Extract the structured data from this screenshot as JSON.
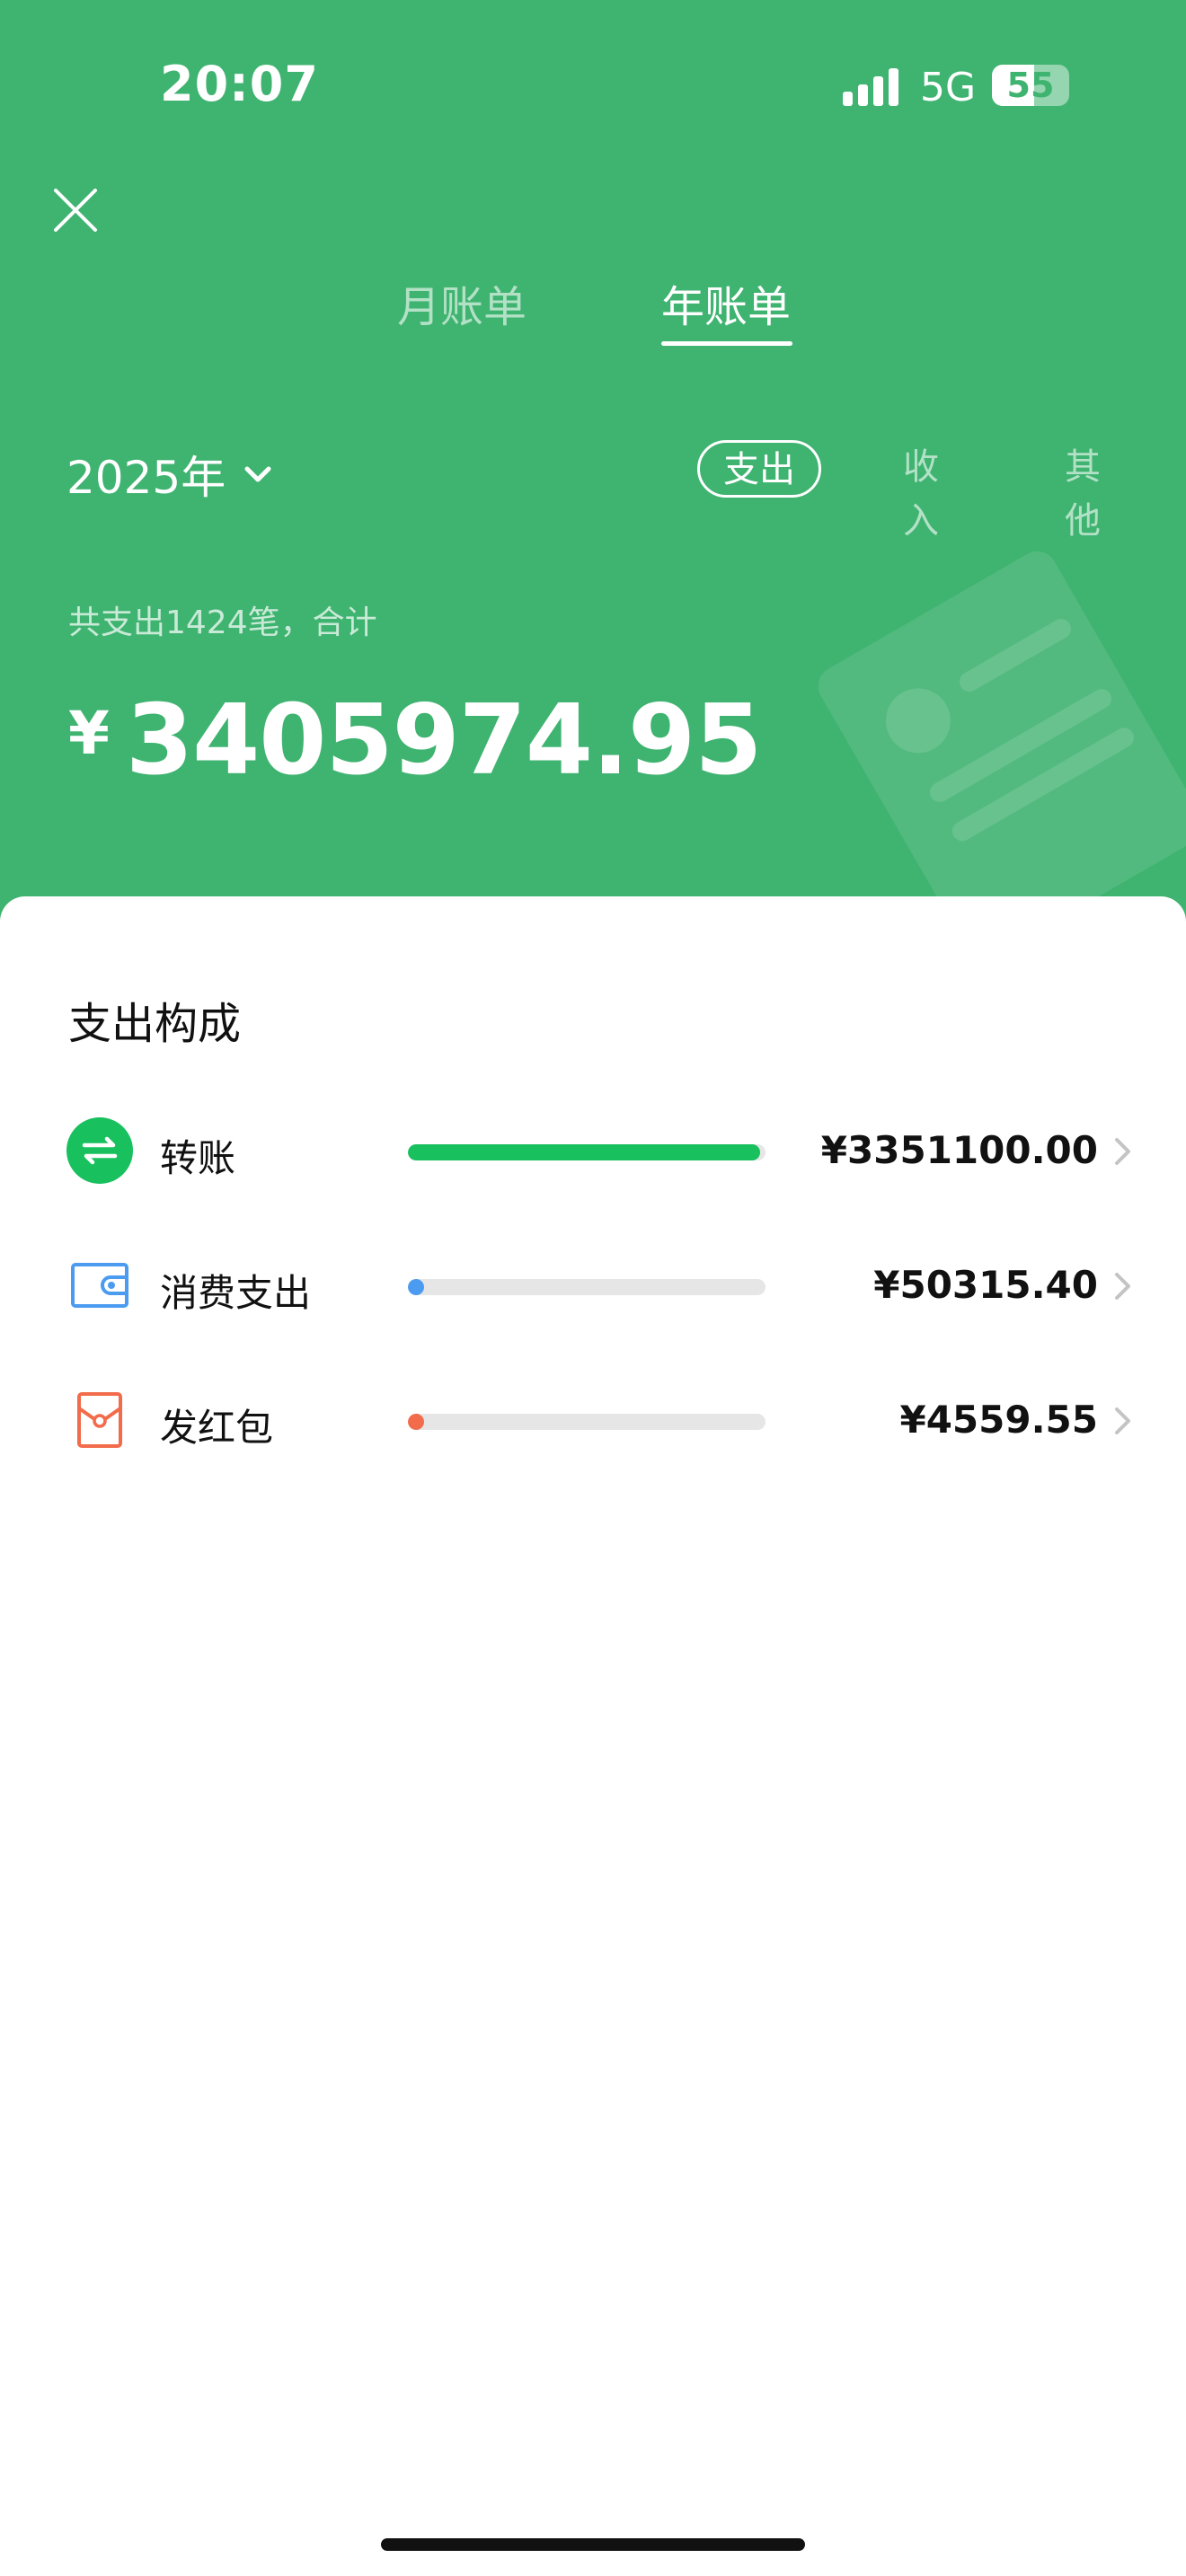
{
  "status_bar": {
    "time": "20:07",
    "network": "5G",
    "battery": "55",
    "battery_level": 0.55
  },
  "nav": {
    "close_icon": "close-icon",
    "tabs": [
      {
        "label": "月账单",
        "active": false
      },
      {
        "label": "年账单",
        "active": true
      }
    ]
  },
  "filters": {
    "year": "2025年",
    "options": [
      {
        "label": "支出",
        "active": true
      },
      {
        "label": "收入",
        "active": false
      },
      {
        "label": "其他",
        "active": false
      }
    ]
  },
  "summary": {
    "caption": "共支出1424笔，合计",
    "currency": "¥",
    "total": "3405974.95"
  },
  "breakdown": {
    "title": "支出构成",
    "items": [
      {
        "icon": "transfer-icon",
        "label": "转账",
        "amount": "¥3351100.00",
        "ratio": 0.984,
        "color": "#18c05e"
      },
      {
        "icon": "wallet-icon",
        "label": "消费支出",
        "amount": "¥50315.40",
        "ratio": 0.015,
        "color": "#4b9bf0"
      },
      {
        "icon": "red-packet-icon",
        "label": "发红包",
        "amount": "¥4559.55",
        "ratio": 0.0013,
        "color": "#f26b4a"
      }
    ]
  },
  "colors": {
    "header_bg": "#3fb370",
    "transfer": "#18c05e",
    "consumption": "#4b9bf0",
    "red_packet": "#f26b4a"
  }
}
